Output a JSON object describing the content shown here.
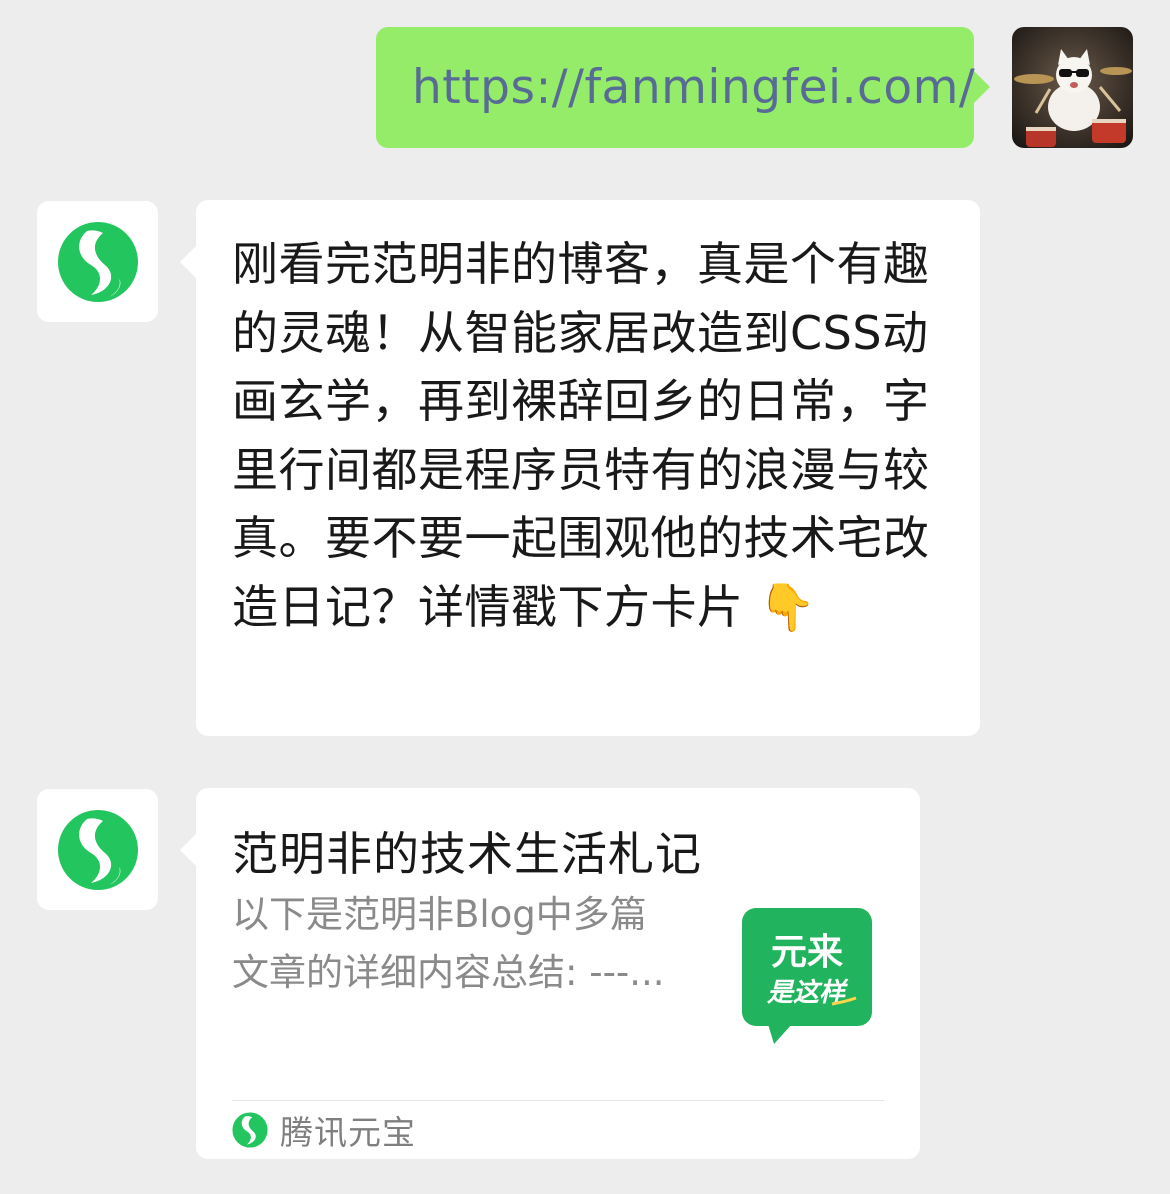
{
  "messages": {
    "outgoing": {
      "text": "https://fanmingfei.com/"
    },
    "reply": {
      "text": "刚看完范明非的博客，真是个有趣的灵魂！从智能家居改造到CSS动画玄学，再到裸辞回乡的日常，字里行间都是程序员特有的浪漫与较真。要不要一起围观他的技术宅改造日记？详情戳下方卡片 👇"
    },
    "card": {
      "title": "范明非的技术生活札记",
      "description": "以下是范明非Blog中多篇文章的详细内容总结: ---...",
      "thumbnail_line1": "元来",
      "thumbnail_line2": "是这样",
      "source": "腾讯元宝"
    }
  },
  "colors": {
    "background": "#ededed",
    "outgoing_bubble": "#95ec69",
    "incoming_bubble": "#ffffff",
    "link": "#576b95",
    "brand_green": "#23c55e"
  },
  "icons": {
    "bot_avatar": "yuanbao-logo-icon",
    "user_avatar": "cat-drummer-avatar",
    "card_thumbnail": "yuanlaishizheyang-badge-icon",
    "source": "yuanbao-small-logo-icon"
  }
}
